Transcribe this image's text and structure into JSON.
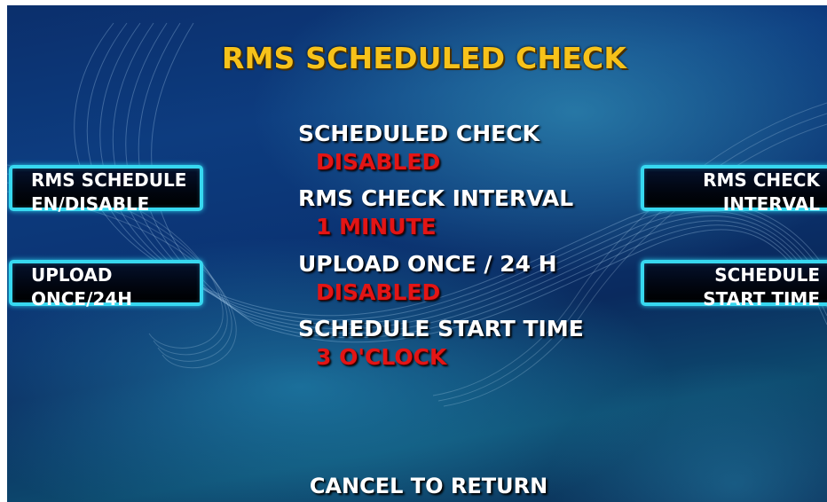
{
  "screen": {
    "title": "RMS SCHEDULED CHECK",
    "cancel_prompt": "CANCEL TO RETURN"
  },
  "settings": [
    {
      "label": "SCHEDULED CHECK",
      "value": "DISABLED"
    },
    {
      "label": "RMS CHECK INTERVAL",
      "value": "1 MINUTE"
    },
    {
      "label": "UPLOAD ONCE / 24 H",
      "value": "DISABLED"
    },
    {
      "label": "SCHEDULE START TIME",
      "value": "3 O'CLOCK"
    }
  ],
  "buttons": {
    "left": [
      {
        "line1": "RMS SCHEDULE",
        "line2": "EN/DISABLE"
      },
      {
        "line1": "UPLOAD",
        "line2": "ONCE/24H"
      }
    ],
    "right": [
      {
        "line1": "RMS CHECK",
        "line2": "INTERVAL"
      },
      {
        "line1": "SCHEDULE",
        "line2": "START TIME"
      }
    ]
  },
  "colors": {
    "title": "#f7c21a",
    "value": "#e31515",
    "button_border": "#37d8f0",
    "background": "#0b3474"
  }
}
